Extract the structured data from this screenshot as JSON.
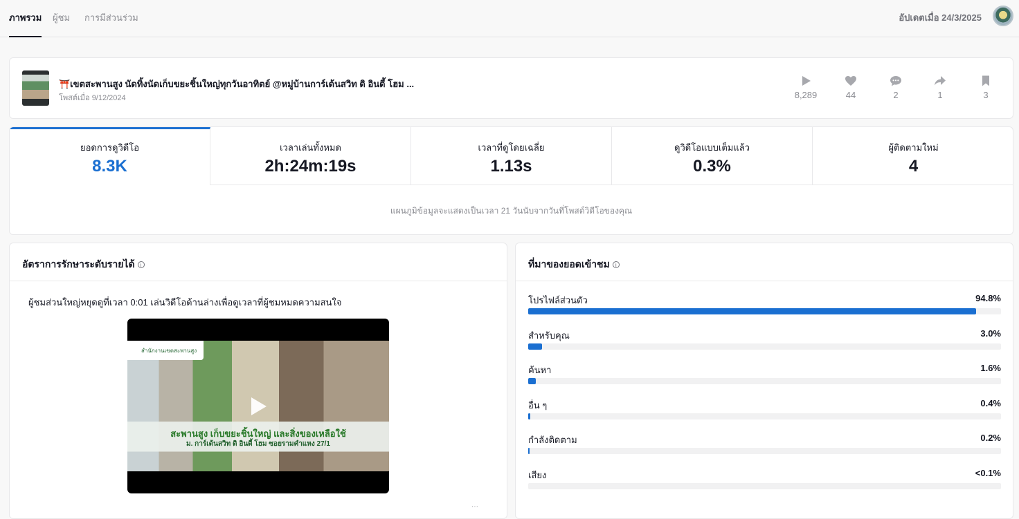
{
  "tabs": [
    {
      "label": "ภาพรวม",
      "active": true
    },
    {
      "label": "ผู้ชม",
      "active": false
    },
    {
      "label": "การมีส่วนร่วม",
      "active": false
    }
  ],
  "header": {
    "updated_text": "อัปเดตเมื่อ 24/3/2025"
  },
  "post": {
    "title": "⛩️เขตสะพานสูง นัดทิ้งนัดเก็บขยะชิ้นใหญ่ทุกวันอาทิตย์ @หมู่บ้านการ์เด้นสวิท ดิ อินดี้ โฮม ...",
    "date": "โพสต์เมื่อ 9/12/2024",
    "stats": {
      "views": "8,289",
      "likes": "44",
      "comments": "2",
      "shares": "1",
      "saves": "3"
    }
  },
  "metrics": [
    {
      "label": "ยอดการดูวิดีโอ",
      "value": "8.3K"
    },
    {
      "label": "เวลาเล่นทั้งหมด",
      "value": "2h:24m:19s"
    },
    {
      "label": "เวลาที่ดูโดยเฉลี่ย",
      "value": "1.13s"
    },
    {
      "label": "ดูวิดีโอแบบเต็มแล้ว",
      "value": "0.3%"
    },
    {
      "label": "ผู้ติดตามใหม่",
      "value": "4"
    }
  ],
  "metrics_note": "แผนภูมิข้อมูลจะแสดงเป็นเวลา 21 วันนับจากวันที่โพสต์วิดีโอของคุณ",
  "retention": {
    "title": "อัตราการรักษาระดับรายได้",
    "description": "ผู้ชมส่วนใหญ่หยุดดูที่เวลา 0:01 เล่นวิดีโอด้านล่างเพื่อดูเวลาที่ผู้ชมหมดความสนใจ",
    "video_banner": "สำนักงานเขตสะพานสูง",
    "video_caption1": "สะพานสูง เก็บขยะชิ้นใหญ่ และสิ่งของเหลือใช้",
    "video_caption2": "ม. การ์เด้นสวิท ดิ อินดี้ โฮม ซอยรามคำแหง 27/1"
  },
  "sources": {
    "title": "ที่มาของยอดเข้าชม",
    "items": [
      {
        "label": "โปรไฟล์ส่วนตัว",
        "pct": "94.8%",
        "value": 94.8
      },
      {
        "label": "สำหรับคุณ",
        "pct": "3.0%",
        "value": 3.0
      },
      {
        "label": "ค้นหา",
        "pct": "1.6%",
        "value": 1.6
      },
      {
        "label": "อื่น ๆ",
        "pct": "0.4%",
        "value": 0.4
      },
      {
        "label": "กำลังติดตาม",
        "pct": "0.2%",
        "value": 0.2
      },
      {
        "label": "เสียง",
        "pct": "<0.1%",
        "value": 0.05
      }
    ]
  },
  "colors": {
    "accent": "#1a6fd1",
    "track": "#f1f1f2"
  }
}
